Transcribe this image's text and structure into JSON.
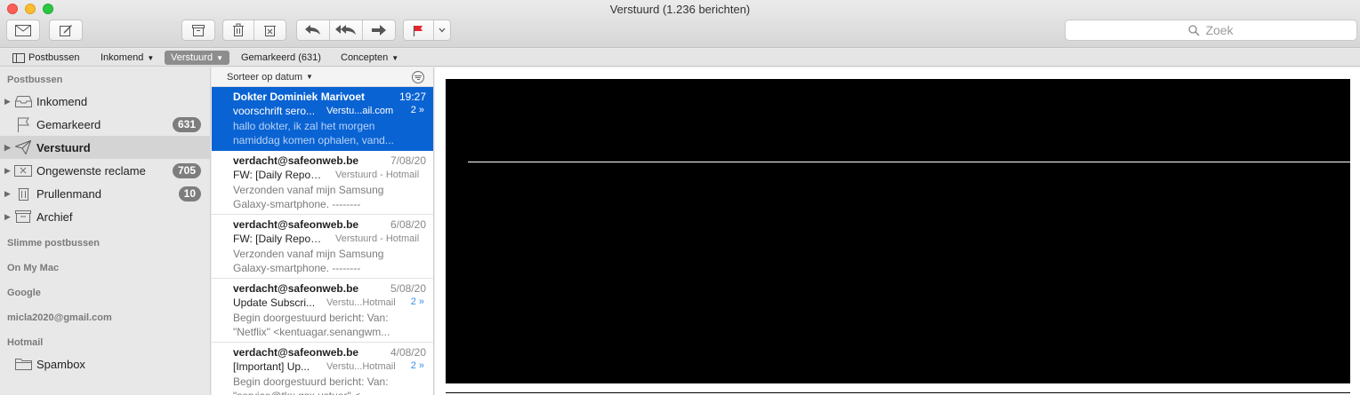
{
  "window": {
    "title": "Verstuurd (1.236 berichten)"
  },
  "toolbar": {
    "search_placeholder": "Zoek",
    "icons": [
      "compose-new-icon",
      "edit-icon",
      "archive-icon",
      "trash-icon",
      "junk-icon",
      "reply-icon",
      "reply-all-icon",
      "forward-icon",
      "flag-icon",
      "chevron-down-icon"
    ],
    "flag_color": "#e8262a"
  },
  "favorites": {
    "items": [
      {
        "label": "Postbussen",
        "chevron": ""
      },
      {
        "label": "Inkomend",
        "chevron": "⌄"
      },
      {
        "label": "Verstuurd",
        "chevron": "⌄"
      },
      {
        "label": "Gemarkeerd (631)",
        "chevron": ""
      },
      {
        "label": "Concepten",
        "chevron": "⌄"
      }
    ]
  },
  "sidebar": {
    "header": "Postbussen",
    "mailboxes": [
      {
        "label": "Inkomend",
        "badge": ""
      },
      {
        "label": "Gemarkeerd",
        "badge": "631"
      },
      {
        "label": "Verstuurd",
        "badge": ""
      },
      {
        "label": "Ongewenste reclame",
        "badge": "705"
      },
      {
        "label": "Prullenmand",
        "badge": "10"
      },
      {
        "label": "Archief",
        "badge": ""
      }
    ],
    "sections": [
      "Slimme postbussen",
      "On My Mac",
      "Google",
      "micla2020@gmail.com",
      "Hotmail"
    ],
    "hotmail_items": [
      {
        "label": "Spambox"
      }
    ]
  },
  "message_list": {
    "sort_label": "Sorteer op datum",
    "messages": [
      {
        "from": "Dokter Dominiek Marivoet",
        "date": "19:27",
        "subject": "voorschrift sero...",
        "mailbox": "Verstu...ail.com",
        "thread": "2 »",
        "preview": "hallo dokter, ik zal het morgen namiddag komen ophalen, vand..."
      },
      {
        "from": "verdacht@safeonweb.be",
        "date": "7/08/20",
        "subject": "FW: [Daily Report...",
        "mailbox": "Verstuurd - Hotmail",
        "thread": "",
        "preview": "Verzonden vanaf mijn Samsung Galaxy-smartphone. -------- Oorspro..."
      },
      {
        "from": "verdacht@safeonweb.be",
        "date": "6/08/20",
        "subject": "FW: [Daily Report...",
        "mailbox": "Verstuurd - Hotmail",
        "thread": "",
        "preview": "Verzonden vanaf mijn Samsung Galaxy-smartphone. -------- Oorspro..."
      },
      {
        "from": "verdacht@safeonweb.be",
        "date": "5/08/20",
        "subject": "Update Subscri...",
        "mailbox": "Verstu...Hotmail",
        "thread": "2 »",
        "preview": "Begin doorgestuurd bericht: Van: \"Netflix\" <kentuagar.senangwm..."
      },
      {
        "from": "verdacht@safeonweb.be",
        "date": "4/08/20",
        "subject": "[Important] Up...",
        "mailbox": "Verstu...Hotmail",
        "thread": "2 »",
        "preview": "Begin doorgestuurd bericht: Van: \"service@tkx.gsx.ustuer\" <..."
      }
    ]
  },
  "colors": {
    "selection": "#0a63d3",
    "badge": "#7d7d7d",
    "thread": "#3d8ef0"
  }
}
